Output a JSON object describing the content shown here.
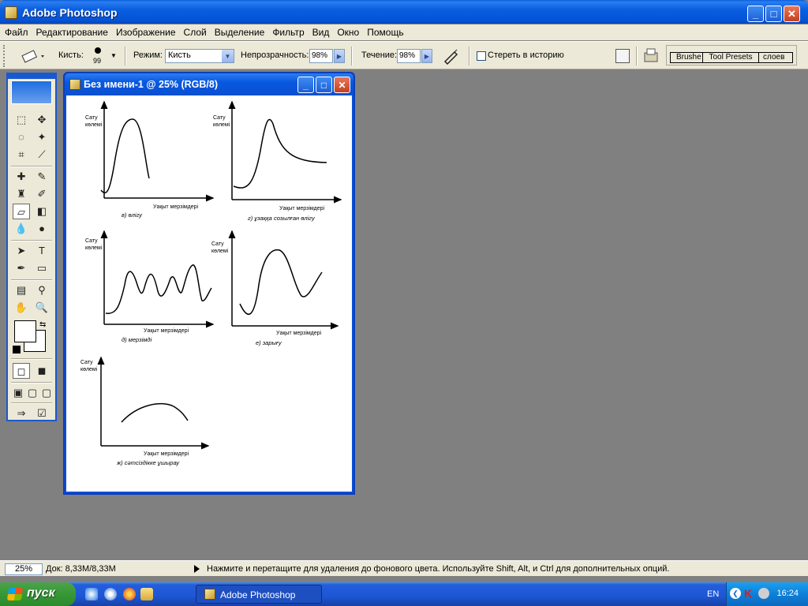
{
  "app": {
    "title": "Adobe Photoshop",
    "window_buttons": {
      "minimize": "_",
      "maximize": "□",
      "close": "✕"
    }
  },
  "menu": [
    "Файл",
    "Редактирование",
    "Изображение",
    "Слой",
    "Выделение",
    "Фильтр",
    "Вид",
    "Окно",
    "Помощь"
  ],
  "options": {
    "brush_label": "Кисть:",
    "brush_size": "99",
    "mode_label": "Режим:",
    "mode_value": "Кисть",
    "opacity_label": "Непрозрачность:",
    "opacity_value": "98%",
    "flow_label": "Течение:",
    "flow_value": "98%",
    "erase_history_label": "Стереть в историю",
    "palette_tabs": [
      "Brushe",
      "Tool Presets",
      "слоев"
    ]
  },
  "document": {
    "title": "Без имени-1 @ 25% (RGB/8)",
    "graphs": [
      {
        "ylabel_1": "Сату",
        "ylabel_2": "көлемі",
        "xlabel": "Уақыт мерзімдері",
        "caption": "в) өлігу"
      },
      {
        "ylabel_1": "Сату",
        "ylabel_2": "көлемі",
        "xlabel": "Уақыт мерзімдері",
        "caption": "г) ұзаққа созылған өлігу"
      },
      {
        "ylabel_1": "Сату",
        "ylabel_2": "көлемі",
        "xlabel": "Уақыт мерзімдері",
        "caption": "д) мерзімді"
      },
      {
        "ylabel_1": "Сату",
        "ylabel_2": "көлемі",
        "xlabel": "Уақыт мерзімдері",
        "caption": "е) зарығу"
      },
      {
        "ylabel_1": "Сату",
        "ylabel_2": "көлемі",
        "xlabel": "Уақыт мерзімдері",
        "caption": "ж) сәтсіздікке ұшырау"
      }
    ]
  },
  "status": {
    "zoom": "25%",
    "doc_size": "Док: 8,33M/8,33M",
    "hint": "Нажмите и перетащите для удаления до фонового цвета.  Используйте Shift, Alt, и Ctrl для дополнительных опций."
  },
  "taskbar": {
    "start": "пуск",
    "task": "Adobe Photoshop",
    "lang": "EN",
    "clock": "16:24"
  }
}
